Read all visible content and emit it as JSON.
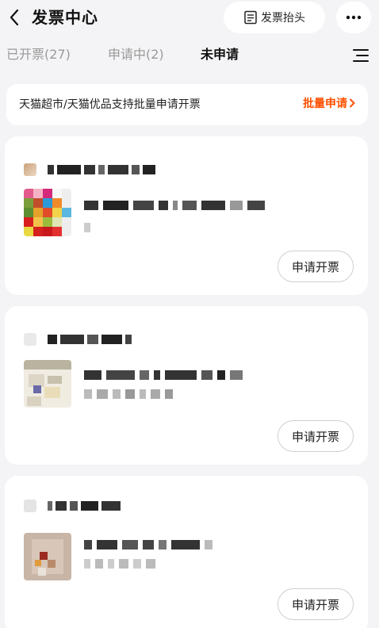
{
  "header": {
    "title": "发票中心",
    "invoice_header_label": "发票抬头",
    "back_icon": "chevron-left-icon",
    "more_icon": "more-dots-icon"
  },
  "tabs": [
    {
      "label": "已开票(27)",
      "active": false
    },
    {
      "label": "申请中(2)",
      "active": false
    },
    {
      "label": "未申请",
      "active": true
    }
  ],
  "banner": {
    "text": "天猫超市/天猫优品支持批量申请开票",
    "link": "批量申请"
  },
  "orders": [
    {
      "apply_label": "申请开票"
    },
    {
      "apply_label": "申请开票"
    },
    {
      "apply_label": "申请开票"
    }
  ],
  "colors": {
    "accent": "#ff5000",
    "background": "#f4f4f6"
  }
}
